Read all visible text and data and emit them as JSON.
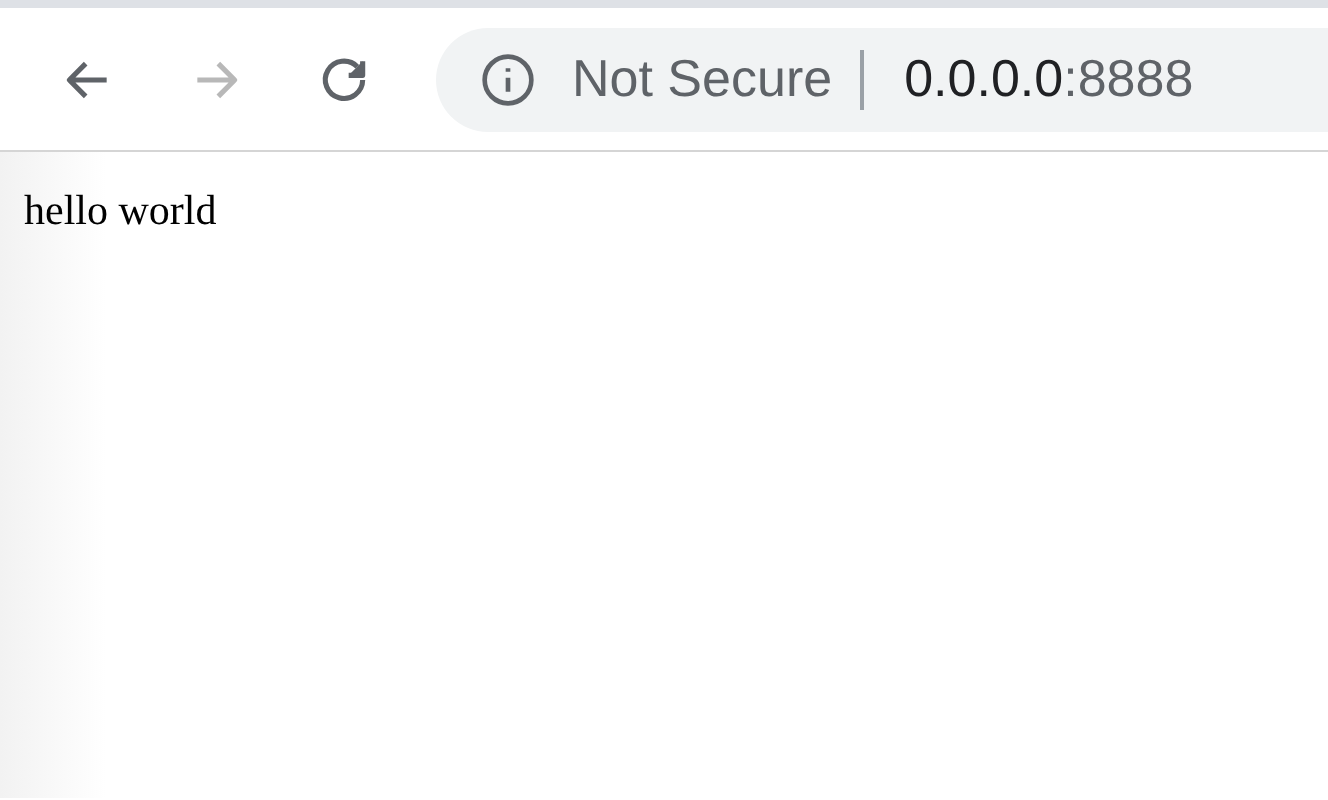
{
  "nav_buttons": [
    {
      "kind": "back",
      "disabled": false
    },
    {
      "kind": "forward",
      "disabled": true
    },
    {
      "kind": "reload",
      "disabled": false
    }
  ],
  "address_bar": {
    "security_label": "Not Secure",
    "url": {
      "host": "0.0.0.0",
      "port": ":8888"
    }
  },
  "page": {
    "text": "hello world"
  }
}
